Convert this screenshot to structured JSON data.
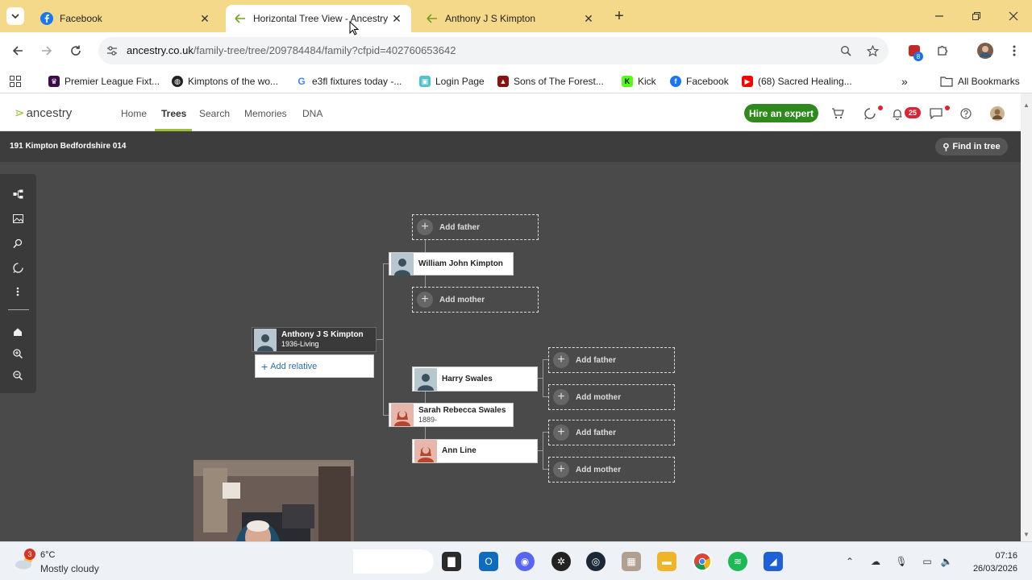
{
  "browser": {
    "tabs": [
      {
        "title": "Facebook",
        "active": false
      },
      {
        "title": "Horizontal Tree View - Ancestry",
        "active": true
      },
      {
        "title": "Anthony J S Kimpton",
        "active": false
      }
    ],
    "url_host": "ancestry.co.uk",
    "url_path": "/family-tree/tree/209784484/family?cfpid=402760653642",
    "extension_badge": "8",
    "bookmarks": [
      "Premier League Fixt...",
      "Kimptons of the wo...",
      "e3fl fixtures today -...",
      "Login Page",
      "Sons of The Forest...",
      "Kick",
      "Facebook",
      "(68) Sacred Healing..."
    ],
    "all_bookmarks": "All Bookmarks"
  },
  "ancestry": {
    "logo": "ancestry",
    "nav": [
      "Home",
      "Trees",
      "Search",
      "Memories",
      "DNA"
    ],
    "active_nav": "Trees",
    "hire_expert": "Hire an expert",
    "notification_count": "25",
    "tree_name": "191 Kimpton Bedfordshire 014",
    "find_in_tree": "Find in tree",
    "home_person": {
      "name": "Anthony J S Kimpton",
      "dates": "1936-Living"
    },
    "add_relative": "Add relative",
    "father": {
      "name": "William John Kimpton"
    },
    "mother": {
      "name": "Sarah Rebecca Swales",
      "dates": "1889-"
    },
    "maternal_grandfather": {
      "name": "Harry Swales"
    },
    "maternal_grandmother": {
      "name": "Ann Line"
    },
    "add_father": "Add father",
    "add_mother": "Add mother"
  },
  "taskbar": {
    "weather_temp": "6°C",
    "weather_desc": "Mostly cloudy",
    "weather_badge": "3",
    "time": "07:16",
    "date": "26/03/2026"
  },
  "colors": {
    "ancestry_green": "#9cbe30",
    "hire_button": "#2f8a1e",
    "tabbar": "#f5d98b",
    "canvas": "#4a4a4a"
  }
}
